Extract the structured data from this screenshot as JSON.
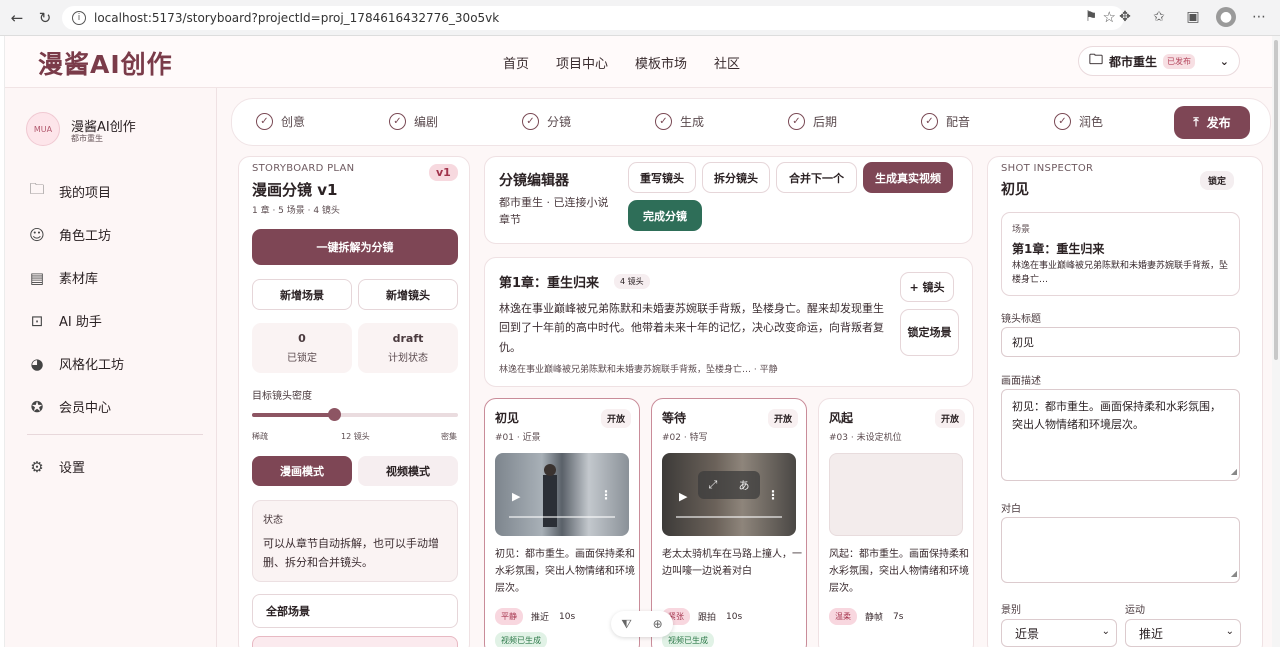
{
  "browser": {
    "url": "localhost:5173/storyboard?projectId=proj_1784616432776_30o5vk"
  },
  "app": {
    "brand": "漫酱AI创作",
    "nav": [
      "首页",
      "项目中心",
      "模板市场",
      "社区"
    ],
    "project": {
      "name": "都市重生",
      "status": "已发布"
    }
  },
  "sidebar": {
    "logo_text": "MUA",
    "title": "漫酱AI创作",
    "subtitle": "都市重生",
    "items": [
      {
        "icon": "folder-icon",
        "label": "我的项目"
      },
      {
        "icon": "character-icon",
        "label": "角色工坊"
      },
      {
        "icon": "archive-icon",
        "label": "素材库"
      },
      {
        "icon": "robot-icon",
        "label": "AI 助手"
      },
      {
        "icon": "palette-icon",
        "label": "风格化工坊"
      },
      {
        "icon": "star-icon",
        "label": "会员中心"
      }
    ],
    "settings": "设置"
  },
  "steps": [
    "创意",
    "编剧",
    "分镜",
    "生成",
    "后期",
    "配音",
    "润色"
  ],
  "publish": "发布",
  "plan": {
    "eyebrow": "STORYBOARD PLAN",
    "title": "漫画分镜 v1",
    "meta": "1 章 · 5 场景 · 4 镜头",
    "version": "v1",
    "primary": "一键拆解为分镜",
    "add_scene": "新增场景",
    "add_shot": "新增镜头",
    "locked_value": "0",
    "locked_label": "已锁定",
    "state_value": "draft",
    "state_label": "计划状态",
    "density_label": "目标镜头密度",
    "density": {
      "min": "稀疏",
      "value": "12 镜头",
      "max": "密集",
      "fraction": 0.4
    },
    "mode_comic": "漫画模式",
    "mode_video": "视频模式",
    "status_title": "状态",
    "status_text": "可以从章节自动拆解，也可以手动增删、拆分和合并镜头。",
    "all_scenes": "全部场景"
  },
  "editor": {
    "title": "分镜编辑器",
    "subtitle": "都市重生 · 已连接小说章节",
    "rewrite": "重写镜头",
    "split": "拆分镜头",
    "merge": "合并下一个",
    "gen_video": "生成真实视频",
    "finish": "完成分镜"
  },
  "chapter": {
    "title": "第1章：重生归来",
    "badge": "4 镜头",
    "body": "林逸在事业巅峰被兄弟陈默和未婚妻苏婉联手背叛，坠楼身亡。醒来却发现重生回到了十年前的高中时代。他带着未来十年的记忆，决心改变命运，向背叛者复仇。",
    "footer": "林逸在事业巅峰被兄弟陈默和未婚妻苏婉联手背叛，坠楼身亡… · 平静",
    "add_shot": "+ 镜头",
    "lock_scene": "锁定场景"
  },
  "shots": [
    {
      "name": "初见",
      "open": "开放",
      "meta": "#01 · 近景",
      "desc": "初见：都市重生。画面保持柔和水彩氛围，突出人物情绪和环境层次。",
      "tags": [
        "平静",
        "推近",
        "10s"
      ],
      "gen": "视频已生成"
    },
    {
      "name": "等待",
      "open": "开放",
      "meta": "#02 · 特写",
      "desc": "老太太骑机车在马路上撞人，一边叫嚎一边说着对白",
      "tags": [
        "紧张",
        "跟拍",
        "10s"
      ],
      "gen": "视频已生成"
    },
    {
      "name": "风起",
      "open": "开放",
      "meta": "#03 · 未设定机位",
      "desc": "风起：都市重生。画面保持柔和水彩氛围，突出人物情绪和环境层次。",
      "tags": [
        "温柔",
        "静帧",
        "7s"
      ]
    }
  ],
  "inspector": {
    "eyebrow": "SHOT INSPECTOR",
    "title": "初见",
    "lock": "锁定",
    "scene_key": "场景",
    "scene_title": "第1章：重生归来",
    "scene_desc": "林逸在事业巅峰被兄弟陈默和未婚妻苏婉联手背叛，坠楼身亡…",
    "shot_title_label": "镜头标题",
    "shot_title_value": "初见",
    "desc_label": "画面描述",
    "desc_value": "初见：都市重生。画面保持柔和水彩氛围，突出人物情绪和环境层次。",
    "dialog_label": "对白",
    "dialog_value": "",
    "size_label": "景别",
    "size_value": "近景",
    "motion_label": "运动",
    "motion_value": "推近"
  },
  "colors": {
    "accent": "#7e4655",
    "success": "#2e6e58",
    "pink_tag": "#f8d7df"
  }
}
